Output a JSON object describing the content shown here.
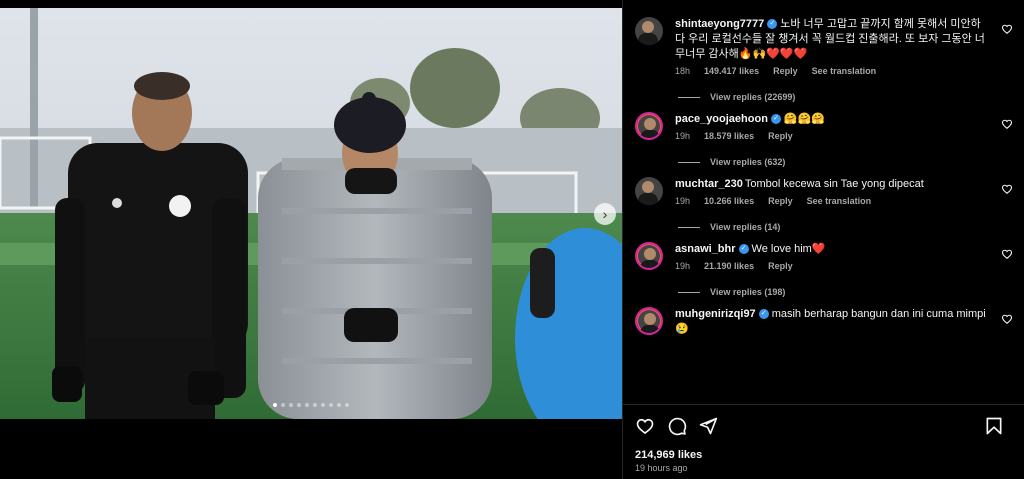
{
  "post": {
    "image_alt": "",
    "carousel": {
      "count": 10,
      "active_index": 0
    }
  },
  "comments": [
    {
      "username": "shintaeyong7777",
      "verified": true,
      "text": "노바 너무 고맙고 끝까지 함께 못해서 미안하다 우리 로컬선수들 잘 챙겨서 꼭 월드컵 진출해라. 또 보자 그동안 너무너무 감사해🔥🙌❤️❤️❤️",
      "time": "18h",
      "likes": "149.417 likes",
      "reply_label": "Reply",
      "translate_label": "See translation",
      "view_replies": "View replies (22699)"
    },
    {
      "username": "pace_yoojaehoon",
      "verified": true,
      "text": "🤗🤗🤗",
      "time": "19h",
      "likes": "18.579 likes",
      "reply_label": "Reply",
      "translate_label": "",
      "view_replies": "View replies (632)"
    },
    {
      "username": "muchtar_230",
      "verified": false,
      "text": "Tombol kecewa sin Tae yong dipecat",
      "time": "19h",
      "likes": "10.266 likes",
      "reply_label": "Reply",
      "translate_label": "See translation",
      "view_replies": "View replies (14)"
    },
    {
      "username": "asnawi_bhr",
      "verified": true,
      "text": "We love him❤️",
      "time": "19h",
      "likes": "21.190 likes",
      "reply_label": "Reply",
      "translate_label": "",
      "view_replies": "View replies (198)"
    },
    {
      "username": "muhgenirizqi97",
      "verified": true,
      "text": "masih berharap bangun dan ini cuma mimpi 😢",
      "time": "",
      "likes": "",
      "reply_label": "",
      "translate_label": "",
      "view_replies": ""
    }
  ],
  "footer": {
    "likes": "214,969 likes",
    "time_ago": "19 hours ago"
  },
  "icons": {
    "like": "heart-icon",
    "comment": "comment-icon",
    "share": "share-icon",
    "save": "bookmark-icon",
    "next": "chevron-right-icon"
  },
  "colors": {
    "verified": "#3897f0",
    "secondary_text": "#a8a8a8",
    "background": "#000000"
  }
}
